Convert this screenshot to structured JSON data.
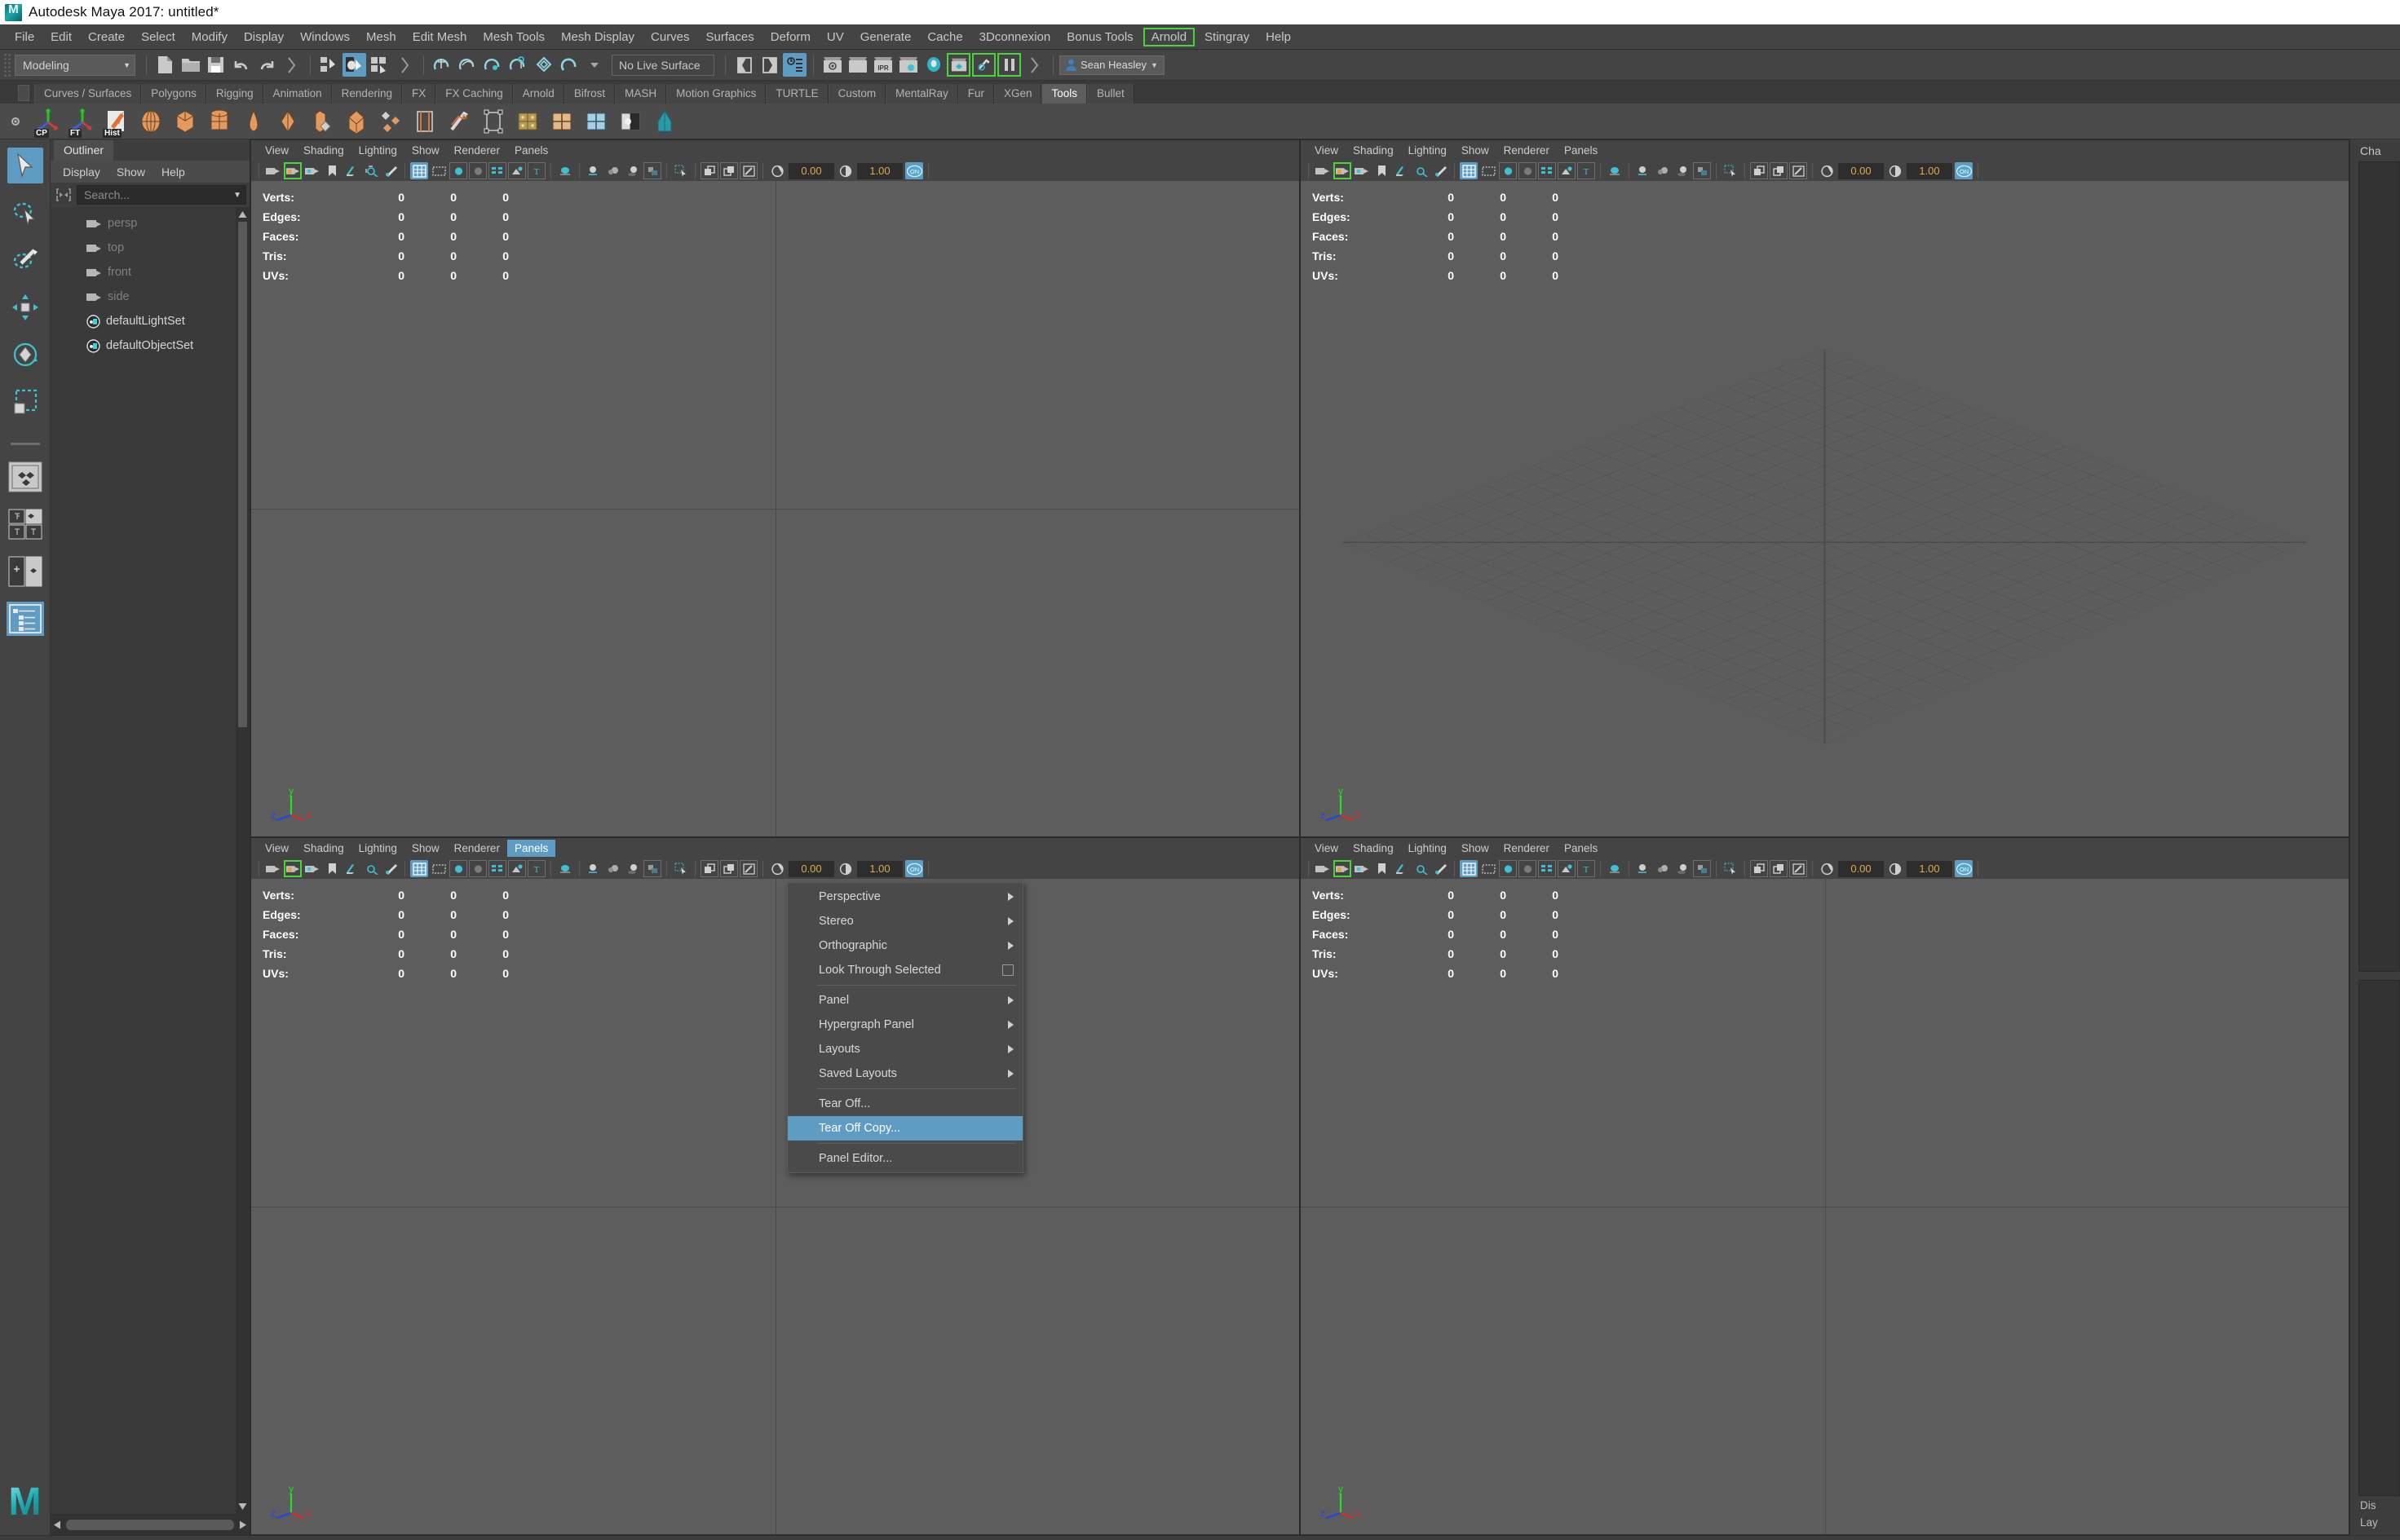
{
  "window": {
    "title": "Autodesk Maya 2017: untitled*",
    "app_icon": "maya-logo-icon"
  },
  "menubar": {
    "items": [
      {
        "label": "File"
      },
      {
        "label": "Edit"
      },
      {
        "label": "Create"
      },
      {
        "label": "Select"
      },
      {
        "label": "Modify"
      },
      {
        "label": "Display"
      },
      {
        "label": "Windows"
      },
      {
        "label": "Mesh"
      },
      {
        "label": "Edit Mesh"
      },
      {
        "label": "Mesh Tools"
      },
      {
        "label": "Mesh Display"
      },
      {
        "label": "Curves"
      },
      {
        "label": "Surfaces"
      },
      {
        "label": "Deform"
      },
      {
        "label": "UV"
      },
      {
        "label": "Generate"
      },
      {
        "label": "Cache"
      },
      {
        "label": "3Dconnexion"
      },
      {
        "label": "Bonus Tools"
      },
      {
        "label": "Arnold",
        "highlight": true
      },
      {
        "label": "Stingray"
      },
      {
        "label": "Help"
      }
    ]
  },
  "toolbar": {
    "menuset": "Modeling",
    "live_surface": "No Live Surface",
    "user": "Sean Heasley",
    "accent_color": "#5e9cc4",
    "highlight_color": "#4ad43b"
  },
  "shelf": {
    "tabs": [
      {
        "label": "Curves / Surfaces"
      },
      {
        "label": "Polygons"
      },
      {
        "label": "Rigging"
      },
      {
        "label": "Animation"
      },
      {
        "label": "Rendering"
      },
      {
        "label": "FX"
      },
      {
        "label": "FX Caching"
      },
      {
        "label": "Arnold"
      },
      {
        "label": "Bifrost"
      },
      {
        "label": "MASH"
      },
      {
        "label": "Motion Graphics"
      },
      {
        "label": "TURTLE"
      },
      {
        "label": "Custom"
      },
      {
        "label": "MentalRay"
      },
      {
        "label": "Fur"
      },
      {
        "label": "XGen"
      },
      {
        "label": "Tools",
        "active": true
      },
      {
        "label": "Bullet"
      }
    ],
    "icon_labels": [
      "CP",
      "FT",
      "Hist"
    ]
  },
  "toolbox": {
    "tools": [
      {
        "name": "select-tool",
        "selected": true
      },
      {
        "name": "lasso-select-tool",
        "selected": false
      },
      {
        "name": "paint-select-tool",
        "selected": false
      },
      {
        "name": "move-tool",
        "selected": false
      },
      {
        "name": "rotate-tool",
        "selected": false
      },
      {
        "name": "scale-tool",
        "selected": false
      }
    ],
    "layouts": [
      {
        "name": "single-perspective-layout",
        "selected": false
      },
      {
        "name": "four-view-layout",
        "selected": false
      },
      {
        "name": "persp-outliner-layout",
        "selected": false
      },
      {
        "name": "persp-graph-layout",
        "selected": true
      }
    ]
  },
  "outliner": {
    "tab_label": "Outliner",
    "menus": [
      {
        "label": "Display"
      },
      {
        "label": "Show"
      },
      {
        "label": "Help"
      }
    ],
    "search_placeholder": "Search...",
    "items": [
      {
        "label": "persp",
        "icon": "camera-icon",
        "dim": true
      },
      {
        "label": "top",
        "icon": "camera-icon",
        "dim": true
      },
      {
        "label": "front",
        "icon": "camera-icon",
        "dim": true
      },
      {
        "label": "side",
        "icon": "camera-icon",
        "dim": true
      },
      {
        "label": "defaultLightSet",
        "icon": "set-icon",
        "dim": false
      },
      {
        "label": "defaultObjectSet",
        "icon": "set-icon",
        "dim": false
      }
    ]
  },
  "viewport_menus": [
    "View",
    "Shading",
    "Lighting",
    "Show",
    "Renderer",
    "Panels"
  ],
  "hud": {
    "rows": [
      {
        "label": "Verts:",
        "values": [
          "0",
          "0",
          "0"
        ]
      },
      {
        "label": "Edges:",
        "values": [
          "0",
          "0",
          "0"
        ]
      },
      {
        "label": "Faces:",
        "values": [
          "0",
          "0",
          "0"
        ]
      },
      {
        "label": "Tris:",
        "values": [
          "0",
          "0",
          "0"
        ]
      },
      {
        "label": "UVs:",
        "values": [
          "0",
          "0",
          "0"
        ]
      }
    ]
  },
  "viewport_toolbar": {
    "exposure_value": "0.00",
    "gamma_value": "1.00",
    "toggle_label": "ON"
  },
  "axis_gizmo": {
    "y_label": "y",
    "x_label": "x",
    "z_label": "z",
    "y_color": "#22e022",
    "x_color": "#ee2222",
    "z_color": "#2244ee"
  },
  "panels_menu": {
    "open": true,
    "owner": "Panels",
    "items": [
      {
        "label": "Perspective",
        "submenu": true
      },
      {
        "label": "Stereo",
        "submenu": true
      },
      {
        "label": "Orthographic",
        "submenu": true
      },
      {
        "label": "Look Through Selected",
        "checkbox": true
      },
      {
        "separator": true
      },
      {
        "label": "Panel",
        "submenu": true
      },
      {
        "label": "Hypergraph Panel",
        "submenu": true
      },
      {
        "label": "Layouts",
        "submenu": true
      },
      {
        "label": "Saved Layouts",
        "submenu": true
      },
      {
        "separator": true
      },
      {
        "label": "Tear Off..."
      },
      {
        "label": "Tear Off Copy...",
        "highlighted": true
      },
      {
        "separator": true
      },
      {
        "label": "Panel Editor..."
      }
    ]
  },
  "right_panels": {
    "channel_box_title": "Cha",
    "display_title": "Dis",
    "layers_title": "Lay"
  }
}
